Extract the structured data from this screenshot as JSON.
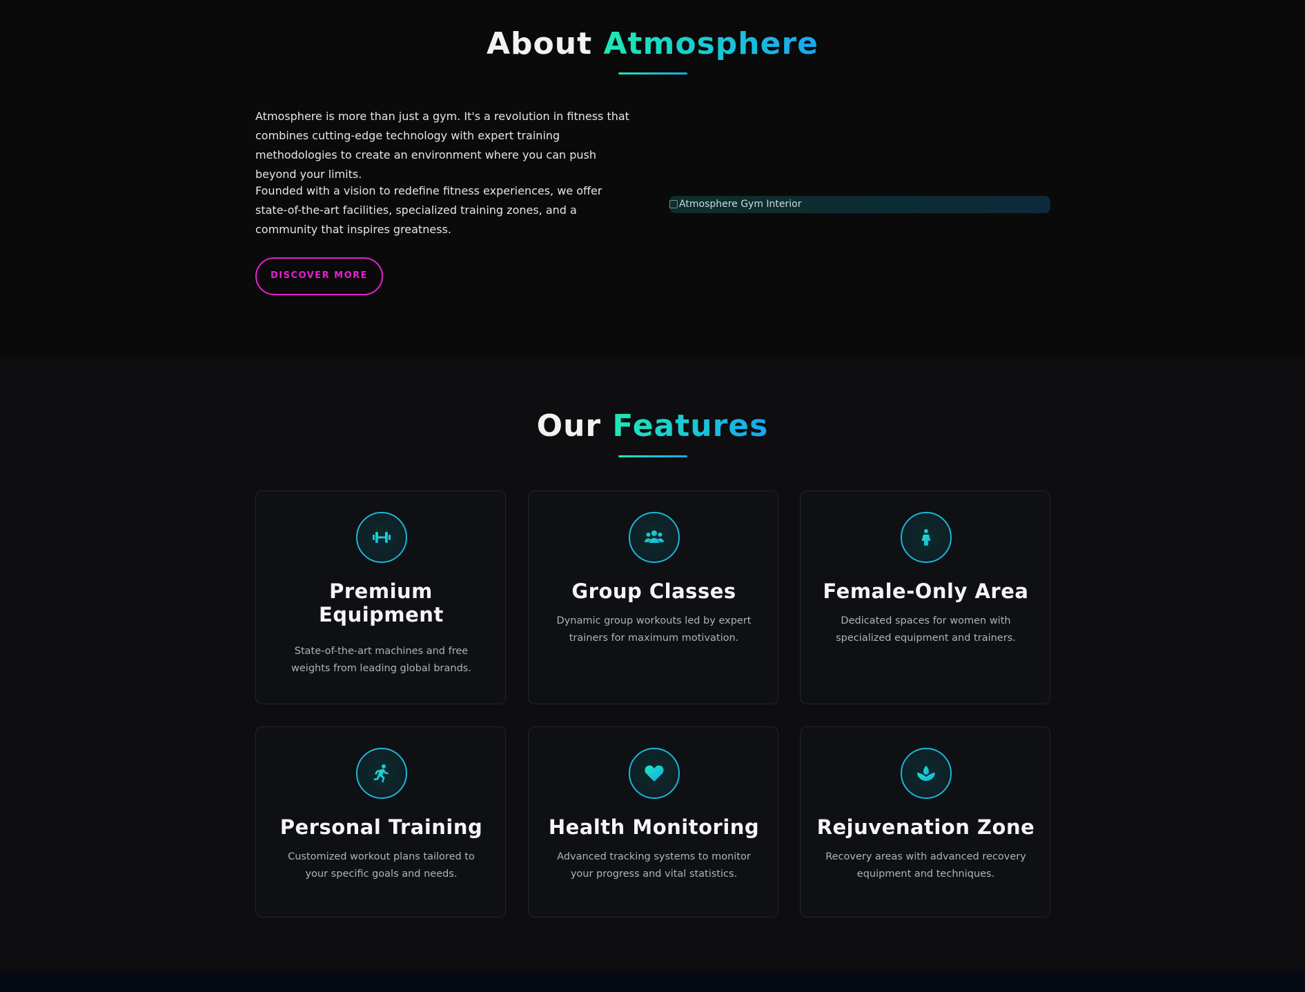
{
  "about": {
    "title_main": "About ",
    "title_accent": "Atmosphere",
    "paragraph_1": "Atmosphere is more than just a gym. It's a revolution in fitness that combines cutting-edge technology with expert training methodologies to create an environment where you can push beyond your limits.",
    "paragraph_2": "Founded with a vision to redefine fitness experiences, we offer state-of-the-art facilities, specialized training zones, and a community that inspires greatness.",
    "button_label": "DISCOVER MORE",
    "image_alt": "Atmosphere Gym Interior"
  },
  "features": {
    "title_main": "Our ",
    "title_accent": "Features",
    "cards": [
      {
        "icon": "dumbbell-icon",
        "title": "Premium Equipment",
        "description": "State-of-the-art machines and free weights from leading global brands."
      },
      {
        "icon": "users-icon",
        "title": "Group Classes",
        "description": "Dynamic group workouts led by expert trainers for maximum motivation."
      },
      {
        "icon": "female-icon",
        "title": "Female-Only Area",
        "description": "Dedicated spaces for women with specialized equipment and trainers."
      },
      {
        "icon": "running-icon",
        "title": "Personal Training",
        "description": "Customized workout plans tailored to your specific goals and needs."
      },
      {
        "icon": "heart-icon",
        "title": "Health Monitoring",
        "description": "Advanced tracking systems to monitor your progress and vital statistics."
      },
      {
        "icon": "spa-icon",
        "title": "Rejuvenation Zone",
        "description": "Recovery areas with advanced recovery equipment and techniques."
      }
    ]
  },
  "colors": {
    "accent_gradient_start": "#1de9b6",
    "accent_gradient_end": "#18a7f0",
    "button_magenta": "#e91fd0",
    "background": "#0a0a0a"
  }
}
